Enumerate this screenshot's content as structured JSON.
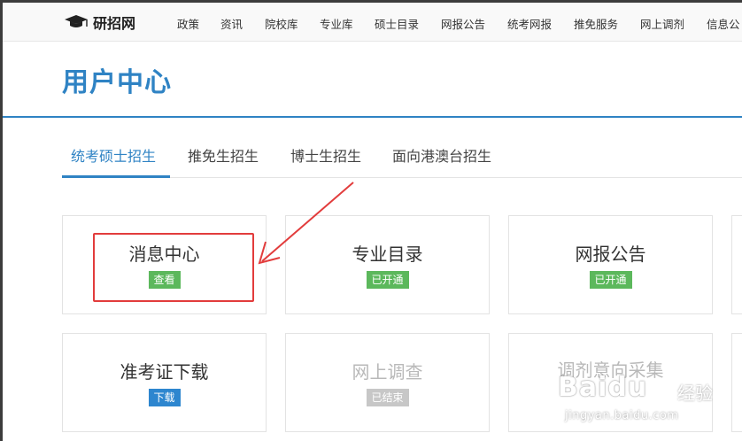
{
  "nav": {
    "logo": "研招网",
    "items": [
      "政策",
      "资讯",
      "院校库",
      "专业库",
      "硕士目录",
      "网报公告",
      "统考网报",
      "推免服务",
      "网上调剂",
      "信息公"
    ]
  },
  "header": {
    "title": "用户中心"
  },
  "tabs": [
    {
      "label": "统考硕士招生",
      "active": true
    },
    {
      "label": "推免生招生",
      "active": false
    },
    {
      "label": "博士生招生",
      "active": false
    },
    {
      "label": "面向港澳台招生",
      "active": false
    }
  ],
  "cards": [
    {
      "title": "消息中心",
      "badge": "查看",
      "badge_color": "#5cb85c"
    },
    {
      "title": "专业目录",
      "badge": "已开通",
      "badge_color": "#5cb85c"
    },
    {
      "title": "网报公告",
      "badge": "已开通",
      "badge_color": "#5cb85c"
    },
    {
      "title": "准考证下载",
      "badge": "下载",
      "badge_color": "#2d86cf"
    },
    {
      "title": "网上调查",
      "badge": "已结束",
      "badge_color": "#c7c7c7"
    },
    {
      "title": "调剂意向采集",
      "badge": "",
      "badge_color": ""
    }
  ],
  "watermark": {
    "brand": "Baidu",
    "cn": "经验",
    "url": "jingyan.baidu.com"
  },
  "colors": {
    "accent": "#2f83c4",
    "annotation_red": "#e23c3c"
  }
}
